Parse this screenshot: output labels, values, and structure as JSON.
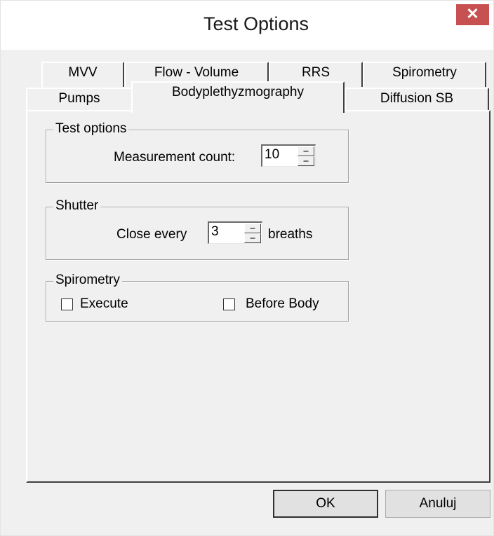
{
  "window": {
    "title": "Test Options",
    "close_glyph": "✕"
  },
  "tabs": {
    "row_back": [
      "MVV",
      "Flow - Volume",
      "RRS",
      "Spirometry"
    ],
    "row_front": [
      "Pumps",
      "Bodyplethyzmography",
      "Diffusion SB"
    ],
    "active": "Bodyplethyzmography"
  },
  "test_options": {
    "legend": "Test options",
    "measurement_label": "Measurement count:",
    "measurement_value": "10"
  },
  "shutter": {
    "legend": "Shutter",
    "close_every_label": "Close every",
    "close_every_value": "3",
    "breaths_label": "breaths"
  },
  "spirometry": {
    "legend": "Spirometry",
    "execute_label": "Execute",
    "execute_checked": false,
    "before_body_label": "Before Body",
    "before_body_checked": false
  },
  "buttons": {
    "ok": "OK",
    "cancel": "Anuluj"
  }
}
